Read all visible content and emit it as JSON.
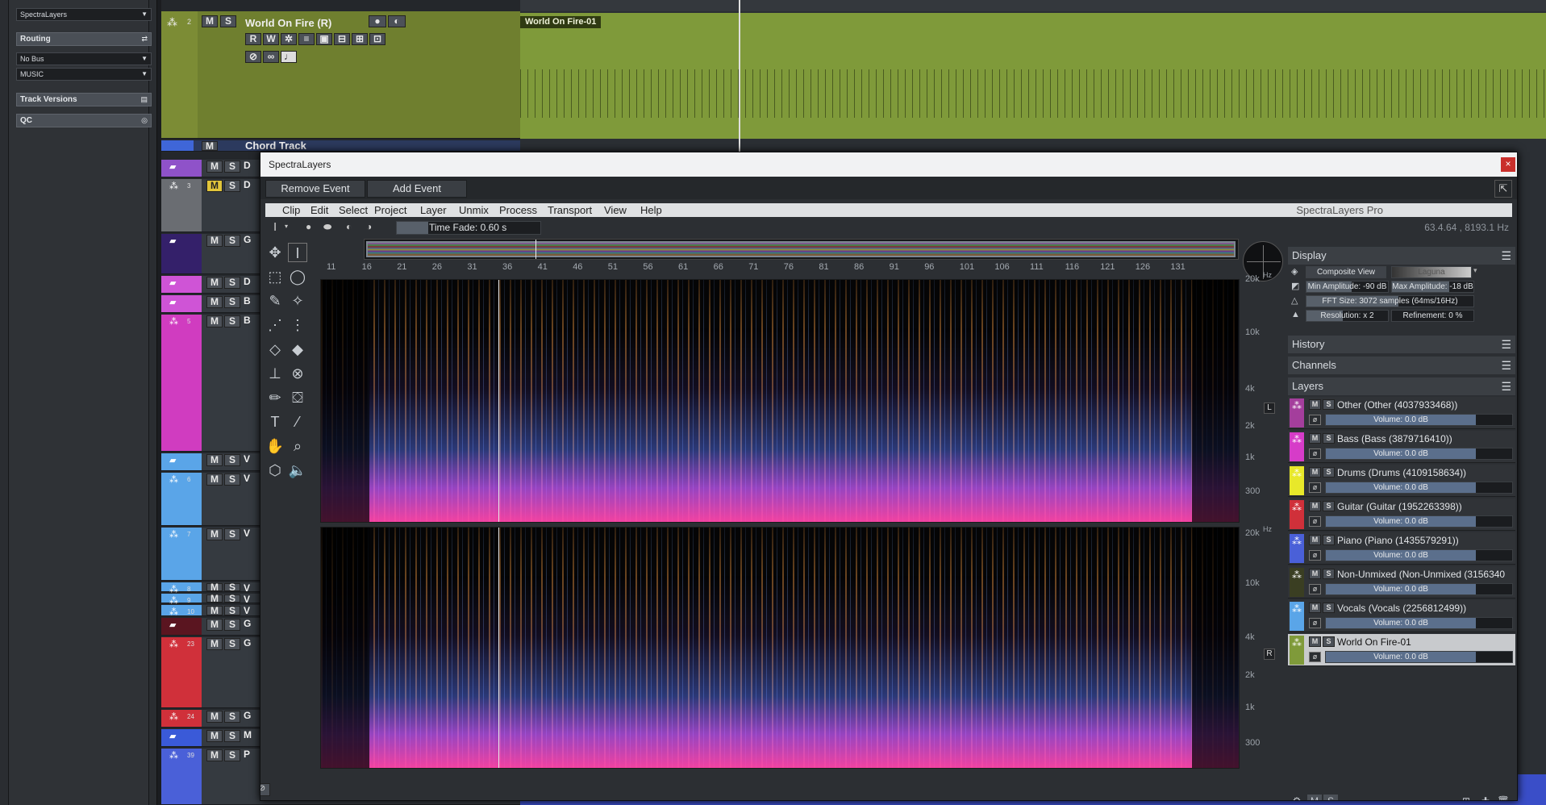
{
  "inspector": {
    "instrument_field": "SpectraLayers",
    "routing_label": "Routing",
    "routing_icon": "routing-icon",
    "bus_field": "No Bus",
    "group_field": "MUSIC",
    "track_versions_label": "Track Versions",
    "qc_label": "QC"
  },
  "tracks": {
    "main_track": {
      "number": "2",
      "name": "World On Fire (R)",
      "mute": "M",
      "solo": "S",
      "read": "R",
      "write": "W",
      "color": "#6f7f2f"
    },
    "chord_track": {
      "name": "Chord Track",
      "mute": "M"
    },
    "rows": [
      {
        "number": "",
        "letter": "D",
        "mute": "M",
        "solo": "S",
        "color": "#8f52c9"
      },
      {
        "number": "3",
        "letter": "D",
        "mute": "M",
        "solo": "S",
        "color": "#6a6d72"
      },
      {
        "number": "",
        "letter": "G",
        "mute": "M",
        "solo": "S",
        "color": "#34206a"
      },
      {
        "number": "",
        "letter": "D",
        "mute": "M",
        "solo": "S",
        "color": "#cf54d6"
      },
      {
        "number": "",
        "letter": "B",
        "mute": "M",
        "solo": "S",
        "color": "#cf54d6"
      },
      {
        "number": "5",
        "letter": "B",
        "mute": "M",
        "solo": "S",
        "color": "#d03cc0"
      },
      {
        "number": "",
        "letter": "V",
        "mute": "M",
        "solo": "S",
        "color": "#5aa5e8"
      },
      {
        "number": "6",
        "letter": "V",
        "mute": "M",
        "solo": "S",
        "color": "#5aa5e8"
      },
      {
        "number": "7",
        "letter": "V",
        "mute": "M",
        "solo": "S",
        "color": "#5aa5e8"
      },
      {
        "number": "8",
        "letter": "V",
        "mute": "M",
        "solo": "S",
        "color": "#5aa5e8"
      },
      {
        "number": "9",
        "letter": "V",
        "mute": "M",
        "solo": "S",
        "color": "#5aa5e8"
      },
      {
        "number": "10",
        "letter": "V",
        "mute": "M",
        "solo": "S",
        "color": "#5aa5e8"
      },
      {
        "number": "",
        "letter": "G",
        "mute": "M",
        "solo": "S",
        "color": "#5a1520"
      },
      {
        "number": "23",
        "letter": "G",
        "mute": "M",
        "solo": "S",
        "color": "#d0303a"
      },
      {
        "number": "24",
        "letter": "G",
        "mute": "M",
        "solo": "S",
        "color": "#d0303a"
      },
      {
        "number": "",
        "letter": "M",
        "mute": "M",
        "solo": "S",
        "color": "#3a5ad8"
      },
      {
        "number": "39",
        "letter": "P",
        "mute": "M",
        "solo": "S",
        "color": "#4a60d8"
      }
    ]
  },
  "arrangement": {
    "event_name": "World On Fire-01",
    "event_color": "#7f9a3a"
  },
  "spectralayers": {
    "window_title": "SpectraLayers",
    "close_glyph": "×",
    "remove_event": "Remove Event",
    "add_event": "Add Event",
    "menu": [
      "Clip",
      "Edit",
      "Select",
      "Project",
      "Layer",
      "Unmix",
      "Process",
      "Transport",
      "View",
      "Help"
    ],
    "brand": "SpectraLayers Pro",
    "time_fade": "Time Fade: 0.60 s",
    "time_fade_fraction": 0.22,
    "coords": "63.4.64 , 8193.1 Hz",
    "ruler_ticks": [
      "11",
      "16",
      "21",
      "26",
      "31",
      "36",
      "41",
      "46",
      "51",
      "56",
      "61",
      "66",
      "71",
      "76",
      "81",
      "86",
      "91",
      "96",
      "101",
      "106",
      "111",
      "116",
      "121",
      "126",
      "131"
    ],
    "freq_labels": [
      "20k",
      "10k",
      "4k",
      "2k",
      "1k",
      "300"
    ],
    "freq_unit": "Hz",
    "channel_left": "L",
    "channel_right": "R"
  },
  "panels": {
    "display_title": "Display",
    "composite_view": "Composite View",
    "colormap": "Laguna",
    "min_amplitude": "Min Amplitude: -90 dB",
    "min_amplitude_fraction": 0.55,
    "max_amplitude": "Max Amplitude: -18 dB",
    "max_amplitude_fraction": 0.7,
    "fft_size": "FFT Size: 3072 samples (64ms/16Hz)",
    "fft_size_fraction": 0.55,
    "resolution": "Resolution: x 2",
    "resolution_fraction": 0.45,
    "refinement": "Refinement: 0 %",
    "refinement_fraction": 0.0,
    "history_title": "History",
    "channels_title": "Channels",
    "layers_title": "Layers",
    "layers": [
      {
        "name": "Other (Other (4037933468))",
        "volume": "Volume: 0.0 dB",
        "color": "#a43e9c"
      },
      {
        "name": "Bass (Bass (3879716410))",
        "volume": "Volume: 0.0 dB",
        "color": "#d63cc8"
      },
      {
        "name": "Drums (Drums (4109158634))",
        "volume": "Volume: 0.0 dB",
        "color": "#e8e82a"
      },
      {
        "name": "Guitar (Guitar (1952263398))",
        "volume": "Volume: 0.0 dB",
        "color": "#d0303a"
      },
      {
        "name": "Piano (Piano (1435579291))",
        "volume": "Volume: 0.0 dB",
        "color": "#4a60d8"
      },
      {
        "name": "Non-Unmixed (Non-Unmixed (3156340",
        "volume": "Volume: 0.0 dB",
        "color": "#3a3e22"
      },
      {
        "name": "Vocals (Vocals (2256812499))",
        "volume": "Volume: 0.0 dB",
        "color": "#5aa5e8"
      },
      {
        "name": "World On Fire-01",
        "volume": "Volume: 0.0 dB",
        "color": "#7f9a3a"
      }
    ],
    "mute_label": "M",
    "solo_label": "S"
  }
}
